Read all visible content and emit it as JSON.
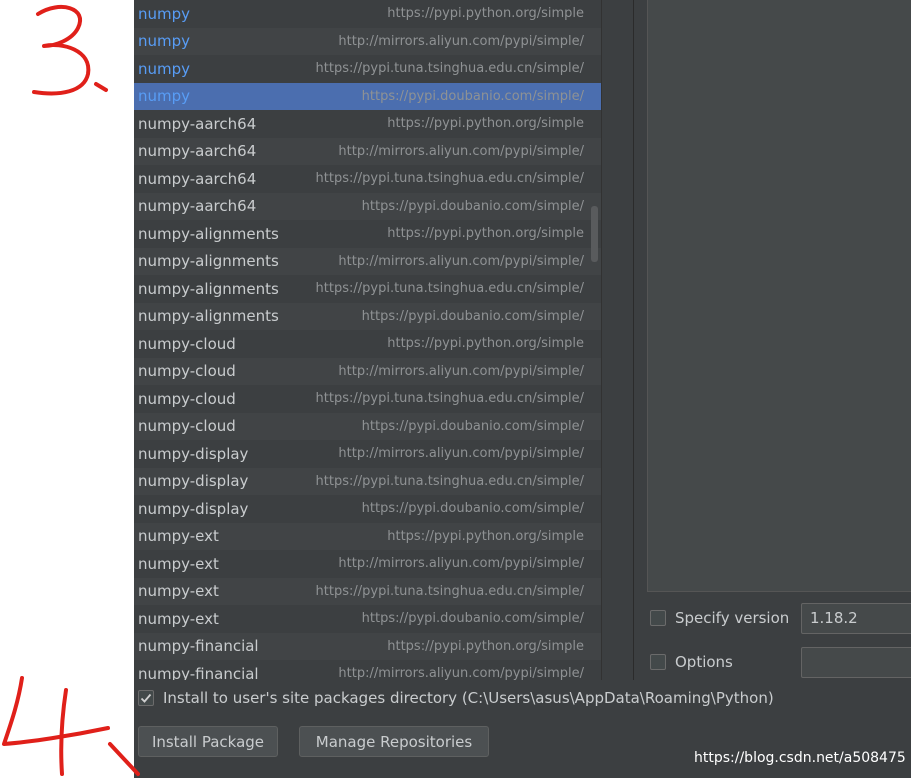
{
  "packages": [
    {
      "name": "numpy",
      "url": "https://pypi.python.org/simple",
      "installed": true
    },
    {
      "name": "numpy",
      "url": "http://mirrors.aliyun.com/pypi/simple/",
      "installed": true
    },
    {
      "name": "numpy",
      "url": "https://pypi.tuna.tsinghua.edu.cn/simple/",
      "installed": true
    },
    {
      "name": "numpy",
      "url": "https://pypi.doubanio.com/simple/",
      "installed": true,
      "selected": true
    },
    {
      "name": "numpy-aarch64",
      "url": "https://pypi.python.org/simple"
    },
    {
      "name": "numpy-aarch64",
      "url": "http://mirrors.aliyun.com/pypi/simple/"
    },
    {
      "name": "numpy-aarch64",
      "url": "https://pypi.tuna.tsinghua.edu.cn/simple/"
    },
    {
      "name": "numpy-aarch64",
      "url": "https://pypi.doubanio.com/simple/"
    },
    {
      "name": "numpy-alignments",
      "url": "https://pypi.python.org/simple"
    },
    {
      "name": "numpy-alignments",
      "url": "http://mirrors.aliyun.com/pypi/simple/"
    },
    {
      "name": "numpy-alignments",
      "url": "https://pypi.tuna.tsinghua.edu.cn/simple/"
    },
    {
      "name": "numpy-alignments",
      "url": "https://pypi.doubanio.com/simple/"
    },
    {
      "name": "numpy-cloud",
      "url": "https://pypi.python.org/simple"
    },
    {
      "name": "numpy-cloud",
      "url": "http://mirrors.aliyun.com/pypi/simple/"
    },
    {
      "name": "numpy-cloud",
      "url": "https://pypi.tuna.tsinghua.edu.cn/simple/"
    },
    {
      "name": "numpy-cloud",
      "url": "https://pypi.doubanio.com/simple/"
    },
    {
      "name": "numpy-display",
      "url": "http://mirrors.aliyun.com/pypi/simple/"
    },
    {
      "name": "numpy-display",
      "url": "https://pypi.tuna.tsinghua.edu.cn/simple/"
    },
    {
      "name": "numpy-display",
      "url": "https://pypi.doubanio.com/simple/"
    },
    {
      "name": "numpy-ext",
      "url": "https://pypi.python.org/simple"
    },
    {
      "name": "numpy-ext",
      "url": "http://mirrors.aliyun.com/pypi/simple/"
    },
    {
      "name": "numpy-ext",
      "url": "https://pypi.tuna.tsinghua.edu.cn/simple/"
    },
    {
      "name": "numpy-ext",
      "url": "https://pypi.doubanio.com/simple/"
    },
    {
      "name": "numpy-financial",
      "url": "https://pypi.python.org/simple"
    },
    {
      "name": "numpy-financial",
      "url": "http://mirrors.aliyun.com/pypi/simple/"
    }
  ],
  "options": {
    "specify_version_label": "Specify version",
    "version_value": "1.18.2",
    "options_label": "Options",
    "options_value": ""
  },
  "install_to_user": {
    "label": "Install to user's site packages directory (C:\\Users\\asus\\AppData\\Roaming\\Python)",
    "checked": true
  },
  "buttons": {
    "install": "Install Package",
    "manage": "Manage Repositories"
  },
  "watermark": "https://blog.csdn.net/a508475",
  "annotations": {
    "step3": "3.",
    "step4": "4."
  },
  "colors": {
    "background": "#3c3f41",
    "selection": "#4b6eaf",
    "installed_name": "#589df6",
    "annotation": "#e0201a"
  }
}
